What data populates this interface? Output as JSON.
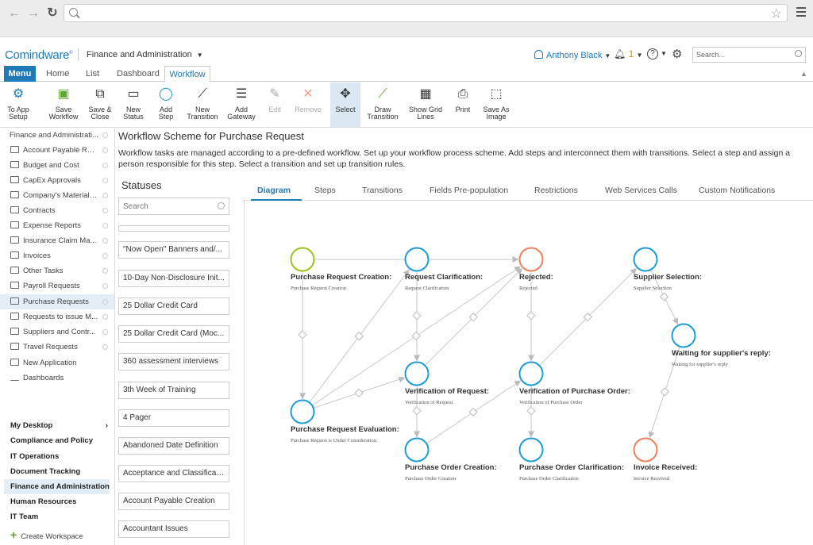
{
  "browser": {
    "address_placeholder": ""
  },
  "app": {
    "logo": "Comindware",
    "workspace": "Finance and Administration",
    "user": "Anthony Black",
    "notif_count": "1",
    "search_placeholder": "Search..."
  },
  "tabs": {
    "menu": "Menu",
    "home": "Home",
    "list": "List",
    "dashboard": "Dashboard",
    "workflow": "Workflow"
  },
  "ribbon": [
    {
      "l1": "To App",
      "l2": "Setup",
      "icon": "gear-arrow-icon"
    },
    {
      "l1": "Save",
      "l2": "Workflow",
      "icon": "save-icon"
    },
    {
      "l1": "Save &",
      "l2": "Close",
      "icon": "save-close-icon"
    },
    {
      "l1": "New",
      "l2": "Status",
      "icon": "status-icon"
    },
    {
      "l1": "Add",
      "l2": "Step",
      "icon": "step-icon"
    },
    {
      "l1": "New",
      "l2": "Transition",
      "icon": "transition-icon"
    },
    {
      "l1": "Add",
      "l2": "Gateway",
      "icon": "gateway-icon"
    },
    {
      "l1": "Edit",
      "l2": "",
      "icon": "edit-icon"
    },
    {
      "l1": "Remove",
      "l2": "",
      "icon": "remove-icon"
    },
    {
      "l1": "Select",
      "l2": "",
      "icon": "select-icon"
    },
    {
      "l1": "Draw",
      "l2": "Transition",
      "icon": "draw-transition-icon"
    },
    {
      "l1": "Show Grid",
      "l2": "Lines",
      "icon": "grid-icon"
    },
    {
      "l1": "Print",
      "l2": "",
      "icon": "print-icon"
    },
    {
      "l1": "Save As",
      "l2": "Image",
      "icon": "image-icon"
    }
  ],
  "sidebar": {
    "apps": [
      "Finance and Administrati...",
      "Account Payable Req...",
      "Budget and Cost",
      "CapEx Approvals",
      "Company's Material ...",
      "Contracts",
      "Expense Reports",
      "Insurance Claim Ma...",
      "Invoices",
      "Other Tasks",
      "Payroll Requests",
      "Purchase Requests",
      "Requests to issue M...",
      "Suppliers and Contr...",
      "Travel Requests"
    ],
    "new_app": "New Application",
    "dashboards": "Dashboards",
    "workspaces": [
      "My Desktop",
      "Compliance and Policy",
      "IT Operations",
      "Document Tracking",
      "Finance and Administration",
      "Human Resources",
      "IT Team"
    ],
    "create_ws": "Create Workspace"
  },
  "page": {
    "title": "Workflow Scheme for Purchase Request",
    "desc": "Workflow tasks are managed according to a pre-defined workflow. Set up your workflow process scheme. Add steps and interconnect them with transitions. Select a step and assign a person responsible for this step. Select a transition and set up transition rules."
  },
  "statuses": {
    "title": "Statuses",
    "search_placeholder": "Search",
    "items": [
      "",
      "\"Now Open\" Banners and/...",
      "10-Day Non-Disclosure Init...",
      "25 Dollar Credit Card",
      "25 Dollar Credit Card (Moc...",
      "360 assessment interviews",
      "3th Week of Training",
      "4 Pager",
      "Abandoned Date Definition",
      "Acceptance and Classificati...",
      "Account Payable Creation",
      "Accountant Issues"
    ]
  },
  "detail_tabs": [
    "Diagram",
    "Steps",
    "Transitions",
    "Fields Pre-population",
    "Restrictions",
    "Web Services Calls",
    "Custom Notifications"
  ],
  "nodes": [
    {
      "title": "Purchase Request Creation:",
      "sub": "Purchase Request Creation",
      "color": "#9ac31c"
    },
    {
      "title": "Request Clarification:",
      "sub": "Request Clarification",
      "color": "#1e9bd7"
    },
    {
      "title": "Rejected:",
      "sub": "Rejected",
      "color": "#f07f5a"
    },
    {
      "title": "Supplier Selection:",
      "sub": "Supplier Selection",
      "color": "#1e9bd7"
    },
    {
      "title": "Waiting for supplier's reply:",
      "sub": "Waiting for supplier's reply",
      "color": "#1e9bd7"
    },
    {
      "title": "Verification of Request:",
      "sub": "Verification of Request",
      "color": "#1e9bd7"
    },
    {
      "title": "Verification of Purchase Order:",
      "sub": "Verification of Purchase Order",
      "color": "#1e9bd7"
    },
    {
      "title": "Purchase Request Evaluation:",
      "sub": "Purchase Request is Under Consideration",
      "color": "#1e9bd7"
    },
    {
      "title": "Purchase Order Creation:",
      "sub": "Purchase Order Creation",
      "color": "#1e9bd7"
    },
    {
      "title": "Purchase Order Clarification:",
      "sub": "Purchase Order Clarification",
      "color": "#1e9bd7"
    },
    {
      "title": "Invoice Received:",
      "sub": "Invoice Received",
      "color": "#f07f5a"
    }
  ]
}
